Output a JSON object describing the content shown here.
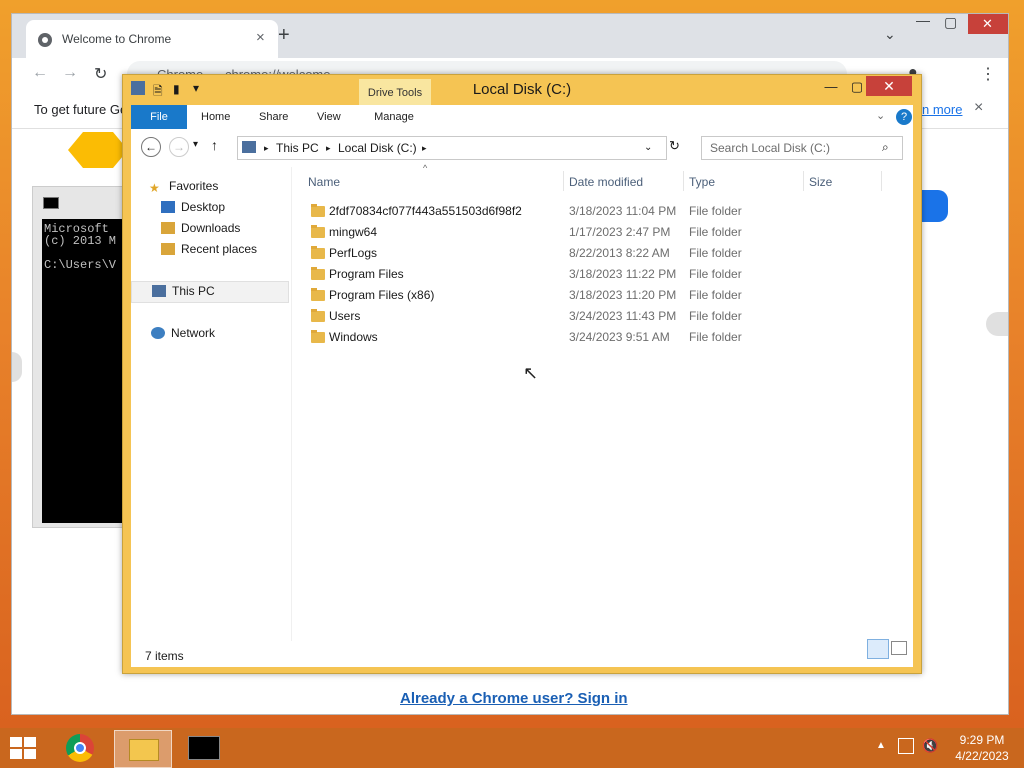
{
  "chrome": {
    "tab_title": "Welcome to Chrome",
    "new_tab": "+",
    "tab_close": "×",
    "omnibox_site": "Chrome",
    "omnibox_url": "chrome://welcome",
    "infobar_text": "To get future Ge",
    "infobar_link": "n more",
    "infobar_close": "×",
    "signin_link": "Already a Chrome user? Sign in",
    "minimize": "—",
    "maximize": "▢",
    "close": "✕"
  },
  "cmd": {
    "text": "Microsoft\n(c) 2013 M\n\nC:\\Users\\V"
  },
  "explorer": {
    "title": "Local Disk (C:)",
    "drive_tools": "Drive Tools",
    "ribbon_tabs": [
      "File",
      "Home",
      "Share",
      "View",
      "Manage"
    ],
    "breadcrumb": [
      "This PC",
      "Local Disk (C:)"
    ],
    "search_placeholder": "Search Local Disk (C:)",
    "nav": {
      "favorites": "Favorites",
      "desktop": "Desktop",
      "downloads": "Downloads",
      "recent": "Recent places",
      "this_pc": "This PC",
      "network": "Network"
    },
    "columns": [
      "Name",
      "Date modified",
      "Type",
      "Size"
    ],
    "rows": [
      {
        "name": "2fdf70834cf077f443a551503d6f98f2",
        "date": "3/18/2023 11:04 PM",
        "type": "File folder"
      },
      {
        "name": "mingw64",
        "date": "1/17/2023 2:47 PM",
        "type": "File folder"
      },
      {
        "name": "PerfLogs",
        "date": "8/22/2013 8:22 AM",
        "type": "File folder"
      },
      {
        "name": "Program Files",
        "date": "3/18/2023 11:22 PM",
        "type": "File folder"
      },
      {
        "name": "Program Files (x86)",
        "date": "3/18/2023 11:20 PM",
        "type": "File folder"
      },
      {
        "name": "Users",
        "date": "3/24/2023 11:43 PM",
        "type": "File folder"
      },
      {
        "name": "Windows",
        "date": "3/24/2023 9:51 AM",
        "type": "File folder"
      }
    ],
    "status": "7 items"
  },
  "taskbar": {
    "time": "9:29 PM",
    "date": "4/22/2023"
  }
}
